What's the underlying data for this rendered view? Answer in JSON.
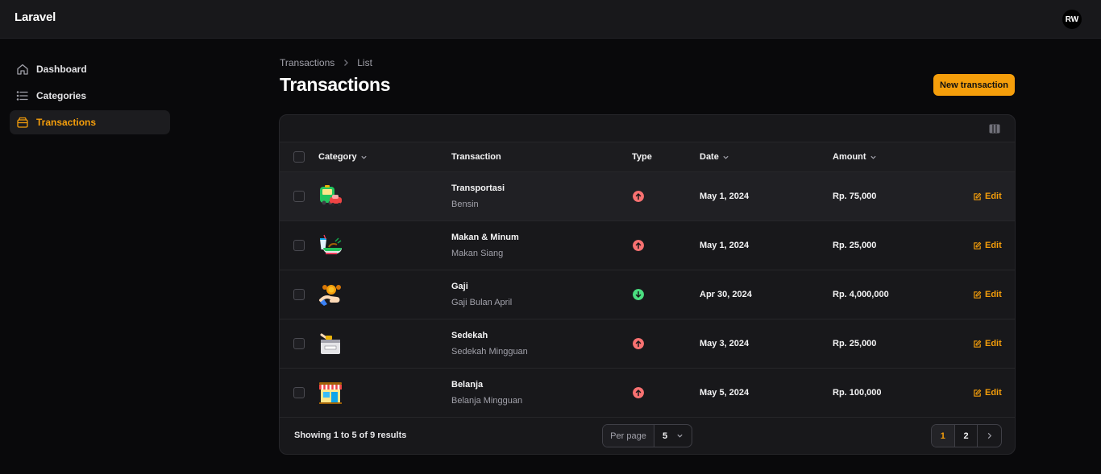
{
  "app": {
    "brand": "Laravel",
    "user_initials": "RW"
  },
  "sidebar": {
    "items": [
      {
        "label": "Dashboard",
        "icon": "home-icon",
        "active": false
      },
      {
        "label": "Categories",
        "icon": "list-icon",
        "active": false
      },
      {
        "label": "Transactions",
        "icon": "box-icon",
        "active": true
      }
    ]
  },
  "breadcrumb": {
    "parent": "Transactions",
    "current": "List"
  },
  "page": {
    "title": "Transactions",
    "new_button": "New transaction"
  },
  "table": {
    "columns": {
      "category": "Category",
      "transaction": "Transaction",
      "type": "Type",
      "date": "Date",
      "amount": "Amount"
    },
    "edit_label": "Edit",
    "rows": [
      {
        "category_icon": "bus-car-icon",
        "name": "Transportasi",
        "description": "Bensin",
        "type": "expense",
        "date": "May 1, 2024",
        "amount": "Rp. 75,000"
      },
      {
        "category_icon": "food-drink-icon",
        "name": "Makan & Minum",
        "description": "Makan Siang",
        "type": "expense",
        "date": "May 1, 2024",
        "amount": "Rp. 25,000"
      },
      {
        "category_icon": "hand-coins-icon",
        "name": "Gaji",
        "description": "Gaji Bulan April",
        "type": "income",
        "date": "Apr 30, 2024",
        "amount": "Rp. 4,000,000"
      },
      {
        "category_icon": "donation-box-icon",
        "name": "Sedekah",
        "description": "Sedekah Mingguan",
        "type": "expense",
        "date": "May 3, 2024",
        "amount": "Rp. 25,000"
      },
      {
        "category_icon": "shop-icon",
        "name": "Belanja",
        "description": "Belanja Mingguan",
        "type": "expense",
        "date": "May 5, 2024",
        "amount": "Rp. 100,000"
      }
    ]
  },
  "footer": {
    "showing": "Showing 1 to 5 of 9 results",
    "per_page_label": "Per page",
    "per_page_value": "5",
    "pages": [
      "1",
      "2"
    ],
    "current_page": "1"
  },
  "colors": {
    "accent": "#f59e0b",
    "expense": "#f87171",
    "income": "#4ade80"
  }
}
